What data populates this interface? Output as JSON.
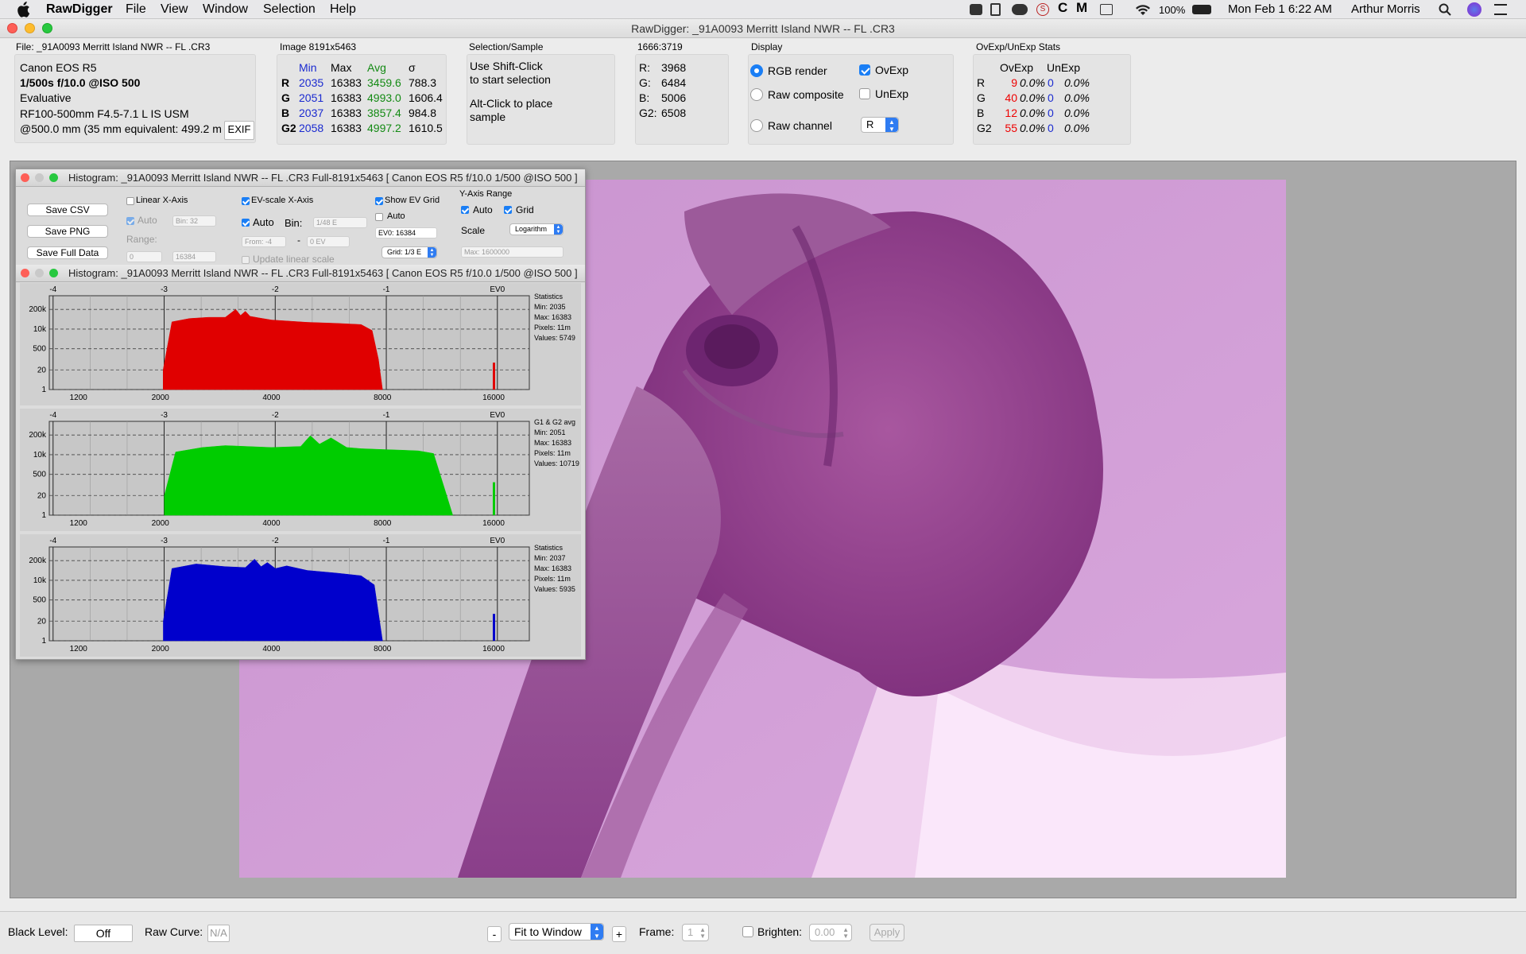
{
  "menubar": {
    "app": "RawDigger",
    "items": [
      "File",
      "View",
      "Window",
      "Selection",
      "Help"
    ],
    "battery": "100%",
    "datetime": "Mon Feb 1  6:22 AM",
    "user": "Arthur Morris"
  },
  "window": {
    "title": "RawDigger: _91A0093  Merritt Island NWR -- FL .CR3"
  },
  "file_panel": {
    "header": "File: _91A0093  Merritt Island NWR -- FL .CR3",
    "camera": "Canon EOS R5",
    "exposure": "1/500s f/10.0 @ISO 500",
    "metering": "Evaluative",
    "lens": "RF100-500mm F4.5-7.1 L IS USM",
    "focal": "@500.0 mm (35 mm equivalent: 499.2 m",
    "exif_button": "EXIF"
  },
  "image_panel": {
    "header": "Image 8191x5463",
    "columns": [
      "Min",
      "Max",
      "Avg",
      "σ"
    ],
    "rows": [
      {
        "ch": "R",
        "min": "2035",
        "max": "16383",
        "avg": "3459.6",
        "sd": "788.3"
      },
      {
        "ch": "G",
        "min": "2051",
        "max": "16383",
        "avg": "4993.0",
        "sd": "1606.4"
      },
      {
        "ch": "B",
        "min": "2037",
        "max": "16383",
        "avg": "3857.4",
        "sd": "984.8"
      },
      {
        "ch": "G2",
        "min": "2058",
        "max": "16383",
        "avg": "4997.2",
        "sd": "1610.5"
      }
    ]
  },
  "selection_panel": {
    "header": "Selection/Sample",
    "line1": "Use Shift-Click",
    "line2": "to start selection",
    "line3": "Alt-Click to place",
    "line4": "sample"
  },
  "coord_panel": {
    "header": "1666:3719",
    "rows": [
      {
        "label": "R:",
        "value": "3968"
      },
      {
        "label": "G:",
        "value": "6484"
      },
      {
        "label": "B:",
        "value": "5006"
      },
      {
        "label": "G2:",
        "value": "6508"
      }
    ]
  },
  "display_panel": {
    "header": "Display",
    "rgb_render": "RGB render",
    "raw_composite": "Raw composite",
    "raw_channel": "Raw channel",
    "ovexp": "OvExp",
    "unexp": "UnExp",
    "channel_value": "R",
    "selected_mode": "RGB render"
  },
  "stats_panel": {
    "header": "OvExp/UnExp Stats",
    "col1": "OvExp",
    "col2": "UnExp",
    "rows": [
      {
        "ch": "R",
        "ov": "9",
        "ovp": "0.0%",
        "un": "0",
        "unp": "0.0%"
      },
      {
        "ch": "G",
        "ov": "40",
        "ovp": "0.0%",
        "un": "0",
        "unp": "0.0%"
      },
      {
        "ch": "B",
        "ov": "12",
        "ovp": "0.0%",
        "un": "0",
        "unp": "0.0%"
      },
      {
        "ch": "G2",
        "ov": "55",
        "ovp": "0.0%",
        "un": "0",
        "unp": "0.0%"
      }
    ]
  },
  "histogram": {
    "window_title": "Histogram: _91A0093  Merritt Island NWR -- FL .CR3 Full-8191x5463 [ Canon EOS R5 f/10.0 1/500 @ISO 500 ]",
    "inner_title": "Histogram: _91A0093  Merritt Island NWR -- FL .CR3 Full-8191x5463 [ Canon EOS R5 f/10.0 1/500 @ISO 500 ]",
    "save_csv": "Save CSV",
    "save_png": "Save PNG",
    "save_full": "Save Full Data",
    "linear_x": "Linear X-Axis",
    "auto": "Auto",
    "bin32": "Bin: 32",
    "range": "Range:",
    "range_from": "0",
    "range_to": "16384",
    "ev_scale": "EV-scale X-Axis",
    "bin_label": "Bin:",
    "bin_ev": "1/48 E",
    "from_ev": "From: -4",
    "to_ev": "0 EV",
    "update_linear": "Update linear scale",
    "show_ev_grid": "Show EV Grid",
    "ev0_value": "EV0: 16384",
    "grid_value": "Grid: 1/3 E",
    "y_axis_range": "Y-Axis Range",
    "grid": "Grid",
    "scale": "Scale",
    "scale_value": "Logarithm",
    "max_value": "Max: 1600000"
  },
  "chart_data": [
    {
      "type": "area",
      "name": "red",
      "color": "#e00000",
      "ev_ticks": [
        "-4",
        "-3",
        "-2",
        "-1",
        "EV0"
      ],
      "x_ticks": [
        "1200",
        "2000",
        "4000",
        "8000",
        "16000"
      ],
      "y_ticks": [
        "200k",
        "10k",
        "500",
        "20",
        "1"
      ],
      "x": [
        2035,
        2150,
        2400,
        2700,
        3000,
        3200,
        3300,
        3400,
        3500,
        3700,
        4000,
        5000,
        6000,
        7000,
        7500,
        7800,
        8000
      ],
      "y": [
        20,
        30000,
        50000,
        60000,
        60000,
        200000,
        80000,
        150000,
        70000,
        55000,
        40000,
        28000,
        24000,
        20000,
        8000,
        100,
        1
      ],
      "stats": [
        "Statistics",
        "Min: 2035",
        "Max: 16383",
        "Pixels: 11m",
        "Values: 5749"
      ]
    },
    {
      "type": "area",
      "name": "green",
      "color": "#00cc00",
      "ev_ticks": [
        "-4",
        "-3",
        "-2",
        "-1",
        "EV0"
      ],
      "x_ticks": [
        "1200",
        "2000",
        "4000",
        "8000",
        "16000"
      ],
      "y_ticks": [
        "200k",
        "10k",
        "500",
        "20",
        "1"
      ],
      "x": [
        2051,
        2200,
        2600,
        3000,
        4000,
        4800,
        5100,
        5400,
        5800,
        6400,
        7000,
        8000,
        9000,
        10000,
        11000,
        11800,
        12400
      ],
      "y": [
        20,
        15000,
        30000,
        40000,
        30000,
        35000,
        180000,
        50000,
        130000,
        30000,
        25000,
        22000,
        20000,
        18000,
        12000,
        50,
        1
      ],
      "stats": [
        "G1 & G2 avg",
        "Min: 2051",
        "Max: 16383",
        "Pixels: 11m",
        "Values: 10719"
      ]
    },
    {
      "type": "area",
      "name": "blue",
      "color": "#0000cc",
      "ev_ticks": [
        "-4",
        "-3",
        "-2",
        "-1",
        "EV0"
      ],
      "x_ticks": [
        "1200",
        "2000",
        "4000",
        "8000",
        "16000"
      ],
      "y_ticks": [
        "200k",
        "10k",
        "500",
        "20",
        "1"
      ],
      "x": [
        2037,
        2150,
        2500,
        3000,
        3400,
        3600,
        3750,
        3900,
        4100,
        4400,
        5000,
        6000,
        7000,
        7600,
        8000
      ],
      "y": [
        20,
        60000,
        120000,
        80000,
        70000,
        250000,
        80000,
        150000,
        60000,
        90000,
        45000,
        30000,
        20000,
        5000,
        1
      ],
      "stats": [
        "Statistics",
        "Min: 2037",
        "Max: 16383",
        "Pixels: 11m",
        "Values: 5935"
      ]
    }
  ],
  "bottom": {
    "black_level_label": "Black Level:",
    "black_level_value": "Off",
    "raw_curve_label": "Raw Curve:",
    "raw_curve_value": "N/A",
    "minus": "-",
    "fit": "Fit to Window",
    "plus": "+",
    "frame_label": "Frame:",
    "frame_value": "1",
    "brighten_label": "Brighten:",
    "brighten_value": "0.00",
    "apply": "Apply"
  }
}
